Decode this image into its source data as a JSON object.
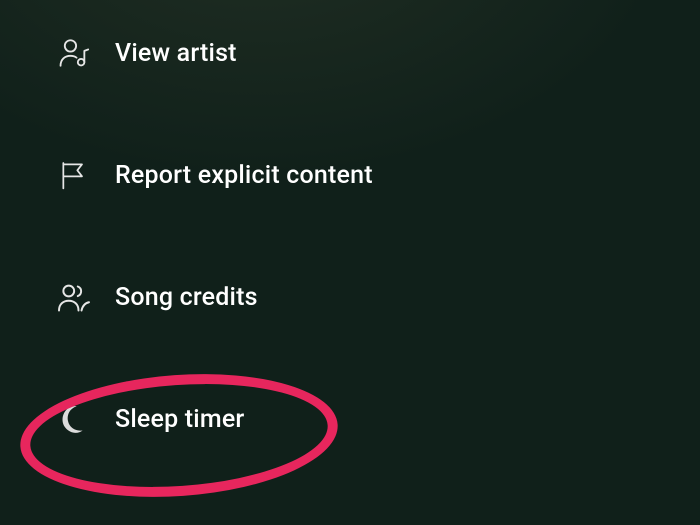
{
  "menu": {
    "items": [
      {
        "label": "View artist"
      },
      {
        "label": "Report explicit content"
      },
      {
        "label": "Song credits"
      },
      {
        "label": "Sleep timer"
      }
    ]
  },
  "annotation": {
    "highlight_target": "sleep-timer",
    "highlight_color": "#e7265d"
  }
}
